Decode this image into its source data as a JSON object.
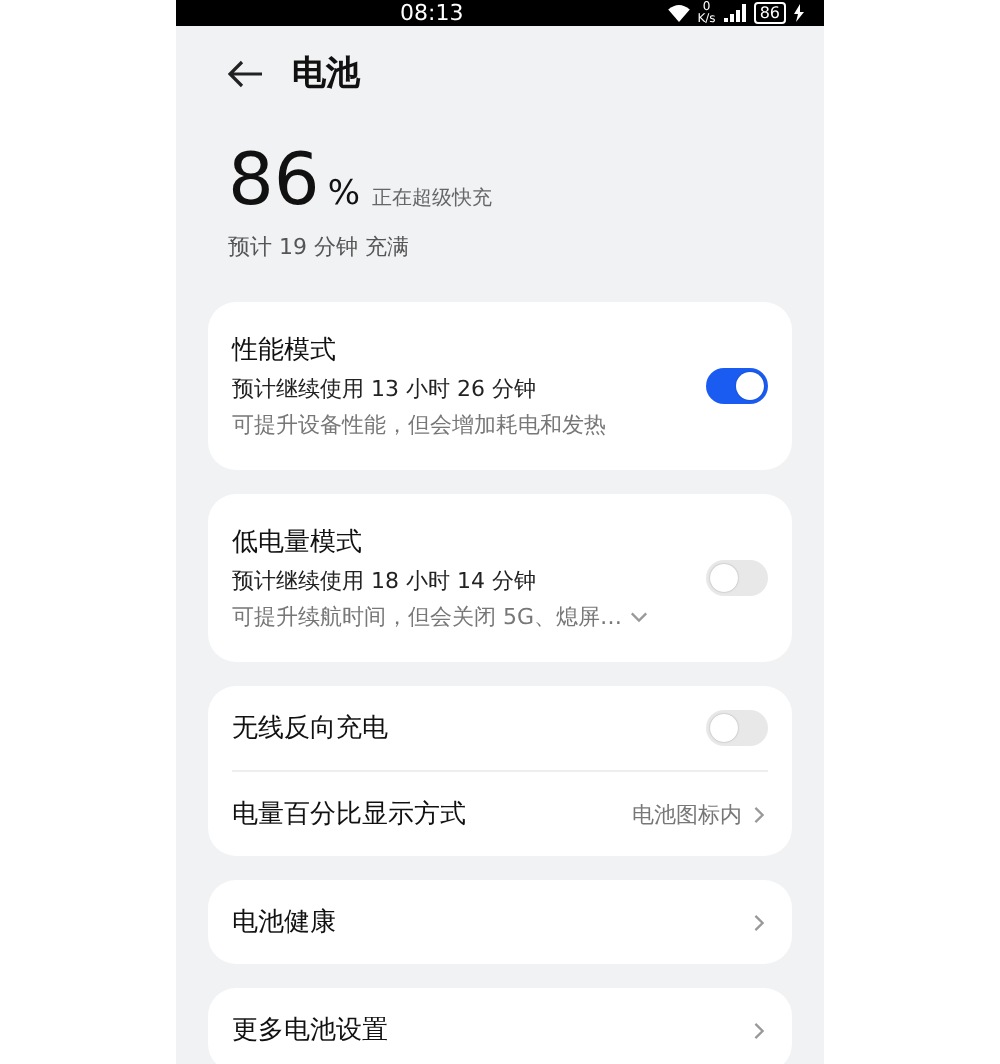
{
  "status_bar": {
    "time": "08:13",
    "speed_value": "0",
    "speed_unit": "K/s",
    "battery": "86"
  },
  "header": {
    "title": "电池"
  },
  "summary": {
    "percent": "86",
    "unit": "%",
    "state": "正在超级快充",
    "estimate": "预计 19 分钟 充满"
  },
  "cards": [
    {
      "rows": [
        {
          "kind": "toggle",
          "label": "性能模式",
          "lines": [
            "预计继续使用 13 小时 26 分钟",
            "可提升设备性能，但会增加耗电和发热"
          ],
          "on": true
        }
      ]
    },
    {
      "rows": [
        {
          "kind": "toggle",
          "label": "低电量模式",
          "lines": [
            "预计继续使用 18 小时 14 分钟",
            "可提升续航时间，但会关闭 5G、熄屏…"
          ],
          "expandable": true,
          "on": false
        }
      ]
    },
    {
      "rows": [
        {
          "kind": "toggle",
          "label": "无线反向充电",
          "on": false
        },
        {
          "kind": "link",
          "label": "电量百分比显示方式",
          "value": "电池图标内"
        }
      ]
    },
    {
      "rows": [
        {
          "kind": "link",
          "label": "电池健康"
        }
      ]
    },
    {
      "rows": [
        {
          "kind": "link",
          "label": "更多电池设置"
        }
      ]
    }
  ]
}
